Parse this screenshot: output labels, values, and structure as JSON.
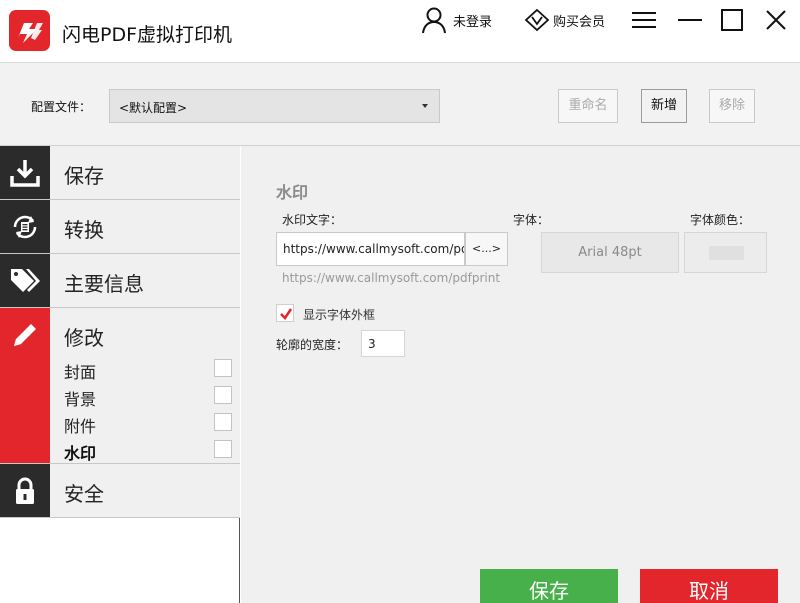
{
  "app": {
    "title": "闪电PDF虚拟打印机"
  },
  "titlebar": {
    "login_label": "未登录",
    "vip_label": "购买会员"
  },
  "profile": {
    "label": "配置文件：",
    "selected": "<默认配置>",
    "rename_label": "重命名",
    "new_label": "新增",
    "remove_label": "移除"
  },
  "sidebar": {
    "items": [
      {
        "label": "保存",
        "icon": "download-icon"
      },
      {
        "label": "转换",
        "icon": "convert-icon"
      },
      {
        "label": "主要信息",
        "icon": "tags-icon"
      },
      {
        "label": "修改",
        "icon": "pencil-icon",
        "active": true
      },
      {
        "label": "安全",
        "icon": "lock-icon"
      }
    ],
    "modify_sub": [
      {
        "label": "封面",
        "checked": false
      },
      {
        "label": "背景",
        "checked": false
      },
      {
        "label": "附件",
        "checked": false
      },
      {
        "label": "水印",
        "checked": false,
        "active": true
      }
    ]
  },
  "watermark": {
    "title": "水印",
    "text_label": "水印文字：",
    "text_value": "https://www.callmysoft.com/pdfprint",
    "browse_label": "<...>",
    "font_label": "字体：",
    "font_value": "Arial 48pt",
    "color_label": "字体颜色：",
    "hint": "https://www.callmysoft.com/pdfprint",
    "outline_label": "显示字体外框",
    "outline_checked": true,
    "outline_width_label": "轮廓的宽度：",
    "outline_width_value": "3"
  },
  "actions": {
    "save_label": "保存",
    "cancel_label": "取消"
  },
  "colors": {
    "brand_red": "#e3262c",
    "save_green": "#47b04b",
    "sidebar_dark": "#2b2b2b"
  }
}
